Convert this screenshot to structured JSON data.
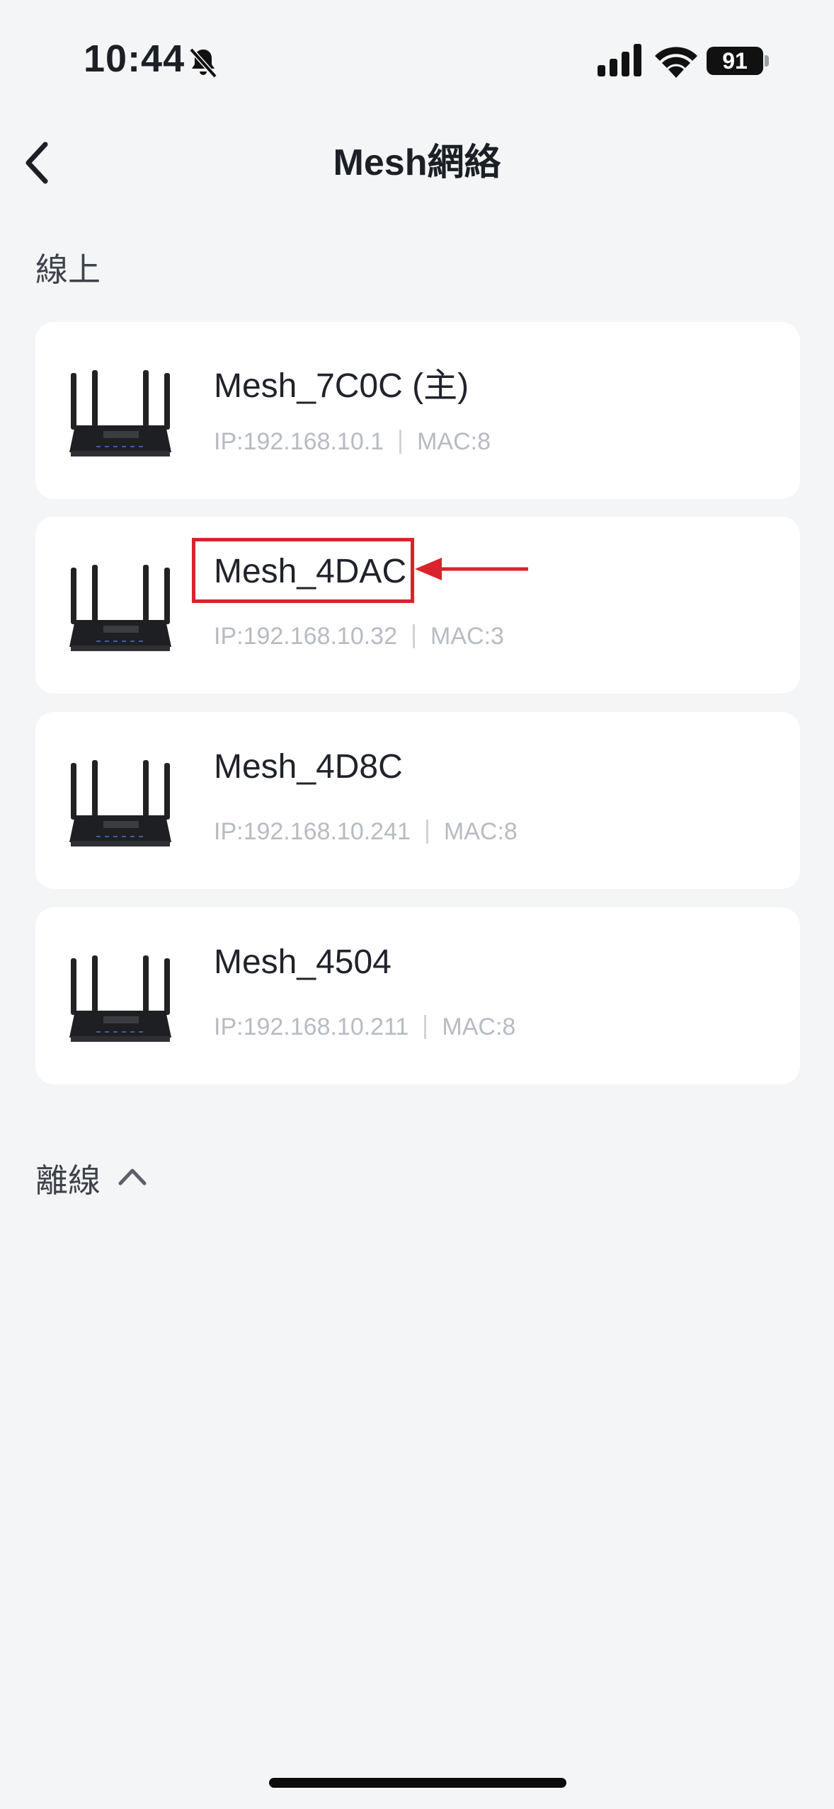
{
  "status_bar": {
    "time": "10:44",
    "battery": "91",
    "icons": [
      "bell-slash-icon",
      "signal-icon",
      "wifi-icon",
      "battery-icon"
    ]
  },
  "header": {
    "title": "Mesh網絡",
    "back_icon": "chevron-left-icon"
  },
  "sections": {
    "online": "線上",
    "offline": "離線"
  },
  "devices": [
    {
      "name": "Mesh_7C0C (主)",
      "ip": "IP:192.168.10.1",
      "mac": "MAC:8"
    },
    {
      "name": "Mesh_4DAC",
      "ip": "IP:192.168.10.32",
      "mac": "MAC:3"
    },
    {
      "name": "Mesh_4D8C",
      "ip": "IP:192.168.10.241",
      "mac": "MAC:8"
    },
    {
      "name": "Mesh_4504",
      "ip": "IP:192.168.10.211",
      "mac": "MAC:8"
    }
  ],
  "annotation": {
    "color": "#d9232d"
  },
  "colors": {
    "background": "#f4f5f7",
    "card": "#ffffff",
    "text": "#1c1f26",
    "muted": "#b7bbc2"
  }
}
